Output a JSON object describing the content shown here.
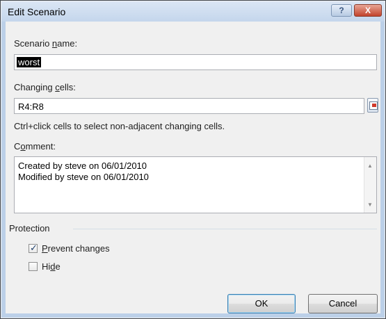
{
  "dialog": {
    "title": "Edit Scenario",
    "help_glyph": "?",
    "close_glyph": "X"
  },
  "scenario_name": {
    "label_pre": "Scenario ",
    "label_key": "n",
    "label_post": "ame:",
    "value": "worst"
  },
  "changing_cells": {
    "label_pre": "Changing ",
    "label_key": "c",
    "label_post": "ells:",
    "value": "R4:R8",
    "hint": "Ctrl+click cells to select non-adjacent changing cells."
  },
  "comment": {
    "label_pre": "C",
    "label_key": "o",
    "label_post": "mment:",
    "lines": [
      "Created by steve on 06/01/2010",
      "Modified by steve on 06/01/2010"
    ]
  },
  "protection": {
    "group_label": "Protection",
    "prevent": {
      "label_key": "P",
      "label_rest": "revent changes",
      "checked": true
    },
    "hide": {
      "label_pre": "Hi",
      "label_key": "d",
      "label_post": "e",
      "checked": false
    }
  },
  "buttons": {
    "ok": "OK",
    "cancel": "Cancel"
  },
  "icons": {
    "scroll_up": "▲",
    "scroll_down": "▼",
    "check": "✓"
  },
  "colors": {
    "titlebar": "#c4d6ec",
    "close": "#c2432c",
    "selection": "#000000"
  }
}
